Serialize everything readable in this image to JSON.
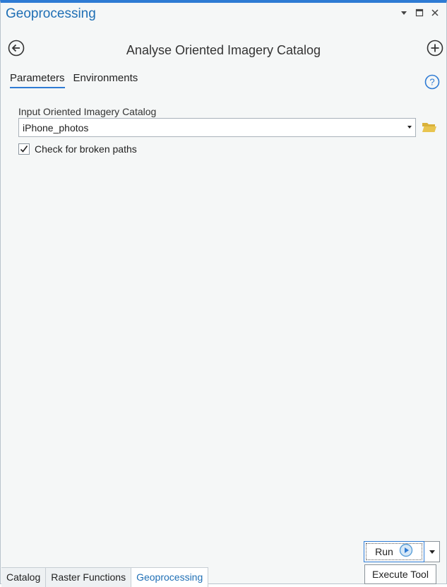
{
  "pane": {
    "title": "Geoprocessing",
    "controls": [
      "menu-dropdown-icon",
      "maximize-icon",
      "close-icon"
    ]
  },
  "tool": {
    "title": "Analyse Oriented Imagery Catalog",
    "back_icon": "back-arrow-icon",
    "add_icon": "add-circle-icon"
  },
  "tabs": [
    {
      "label": "Parameters",
      "active": true
    },
    {
      "label": "Environments",
      "active": false
    }
  ],
  "parameters": {
    "input_label": "Input Oriented Imagery Catalog",
    "input_value": "iPhone_photos",
    "check_label": "Check for broken paths",
    "check_checked": true
  },
  "run": {
    "label": "Run",
    "tooltip": "Execute Tool"
  },
  "bottom_tabs": [
    {
      "label": "Catalog",
      "active": false
    },
    {
      "label": "Raster Functions",
      "active": false
    },
    {
      "label": "Geoprocessing",
      "active": true
    }
  ],
  "colors": {
    "accent": "#2e7bd4",
    "title": "#1f6fb5",
    "folder": "#e8c44f",
    "background": "#f5f7f7"
  }
}
